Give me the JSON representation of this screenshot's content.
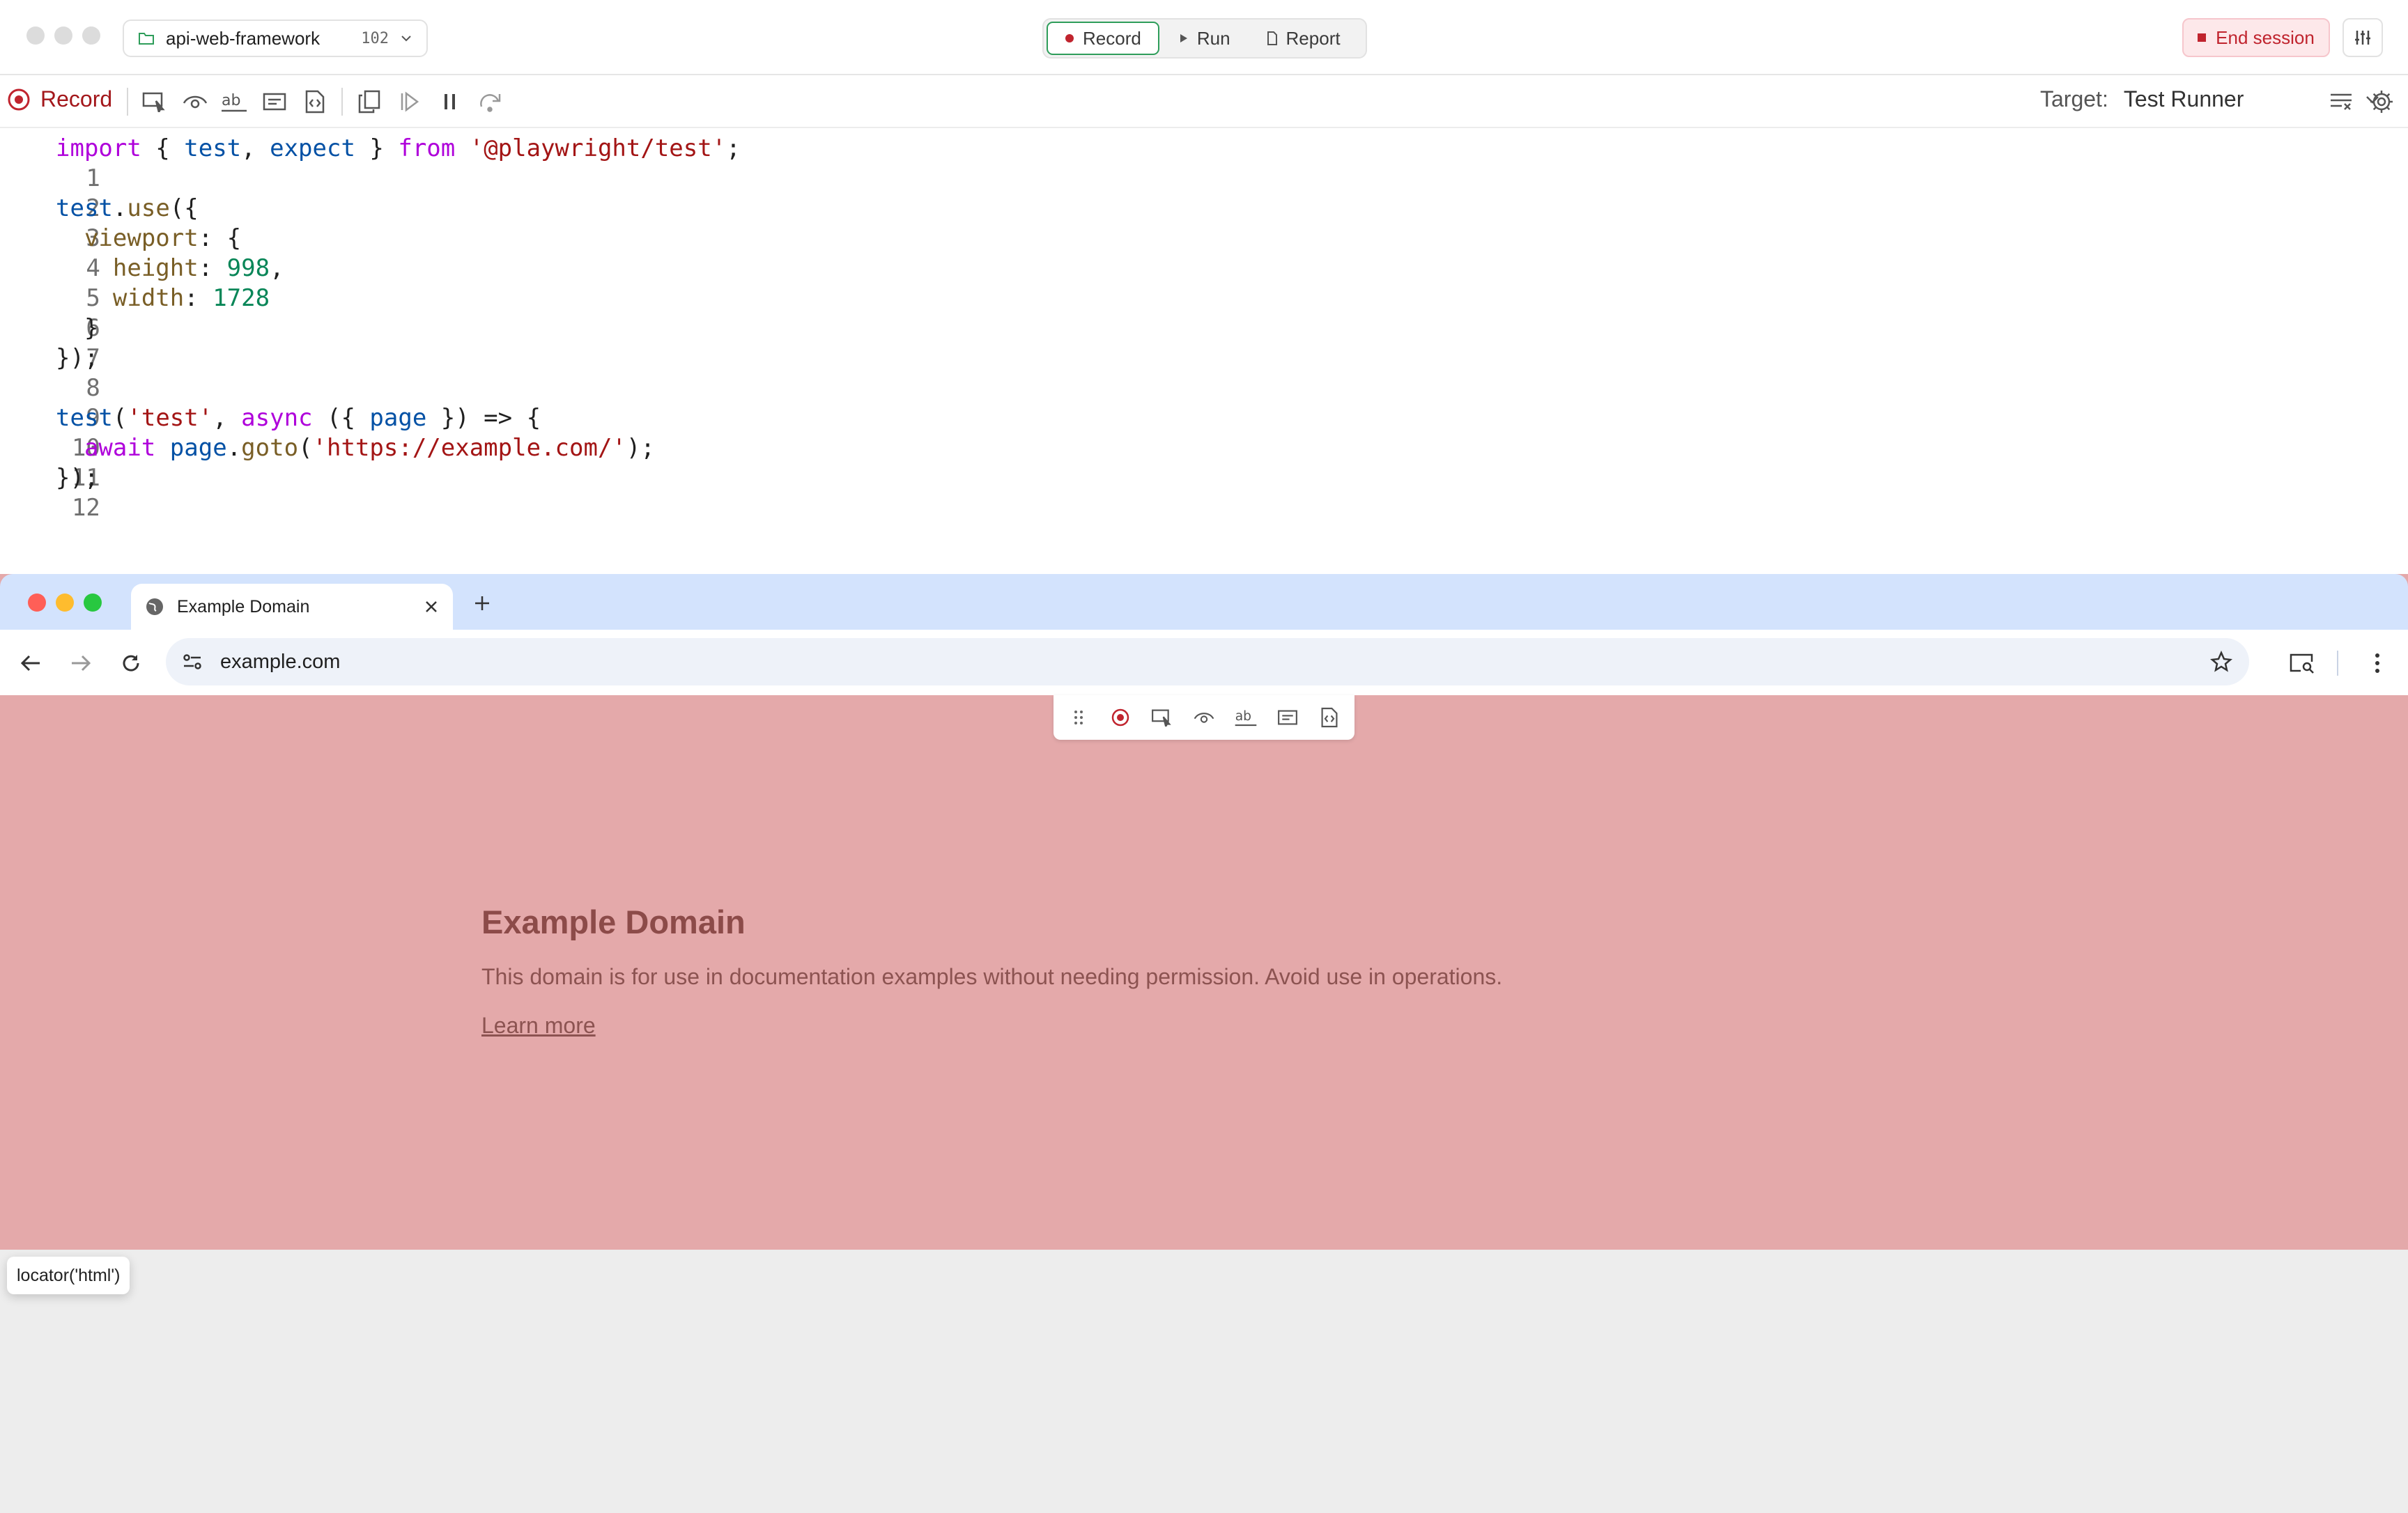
{
  "app": {
    "project_name": "api-web-framework",
    "project_count": "102",
    "modes": [
      {
        "label": "Record",
        "active": true
      },
      {
        "label": "Run",
        "active": false
      },
      {
        "label": "Report",
        "active": false
      }
    ],
    "end_session_label": "End session",
    "accent_color": "#2e9d5a",
    "danger_color": "#c0242e"
  },
  "toolbar": {
    "record_label": "Record",
    "target_label": "Target:",
    "target_value": "Test Runner",
    "icons": [
      "pick-locator-icon",
      "assert-visibility-icon",
      "assert-text-icon",
      "assert-value-icon",
      "assert-snapshot-icon",
      "copy-icon",
      "resume-icon",
      "pause-icon",
      "step-over-icon",
      "clear-icon",
      "settings-icon"
    ]
  },
  "editor": {
    "lines": [
      {
        "n": "1"
      },
      {
        "n": "2"
      },
      {
        "n": "3"
      },
      {
        "n": "4"
      },
      {
        "n": "5"
      },
      {
        "n": "6"
      },
      {
        "n": "7"
      },
      {
        "n": "8"
      },
      {
        "n": "9"
      },
      {
        "n": "10"
      },
      {
        "n": "11"
      },
      {
        "n": "12"
      }
    ],
    "tokens": {
      "l1": [
        "import",
        " { ",
        "test",
        ", ",
        "expect",
        " } ",
        "from",
        " ",
        "'@playwright/test'",
        ";"
      ],
      "l3": [
        "test",
        ".",
        "use",
        "({"
      ],
      "l4": [
        "  ",
        "viewport",
        ": {"
      ],
      "l5": [
        "    ",
        "height",
        ": ",
        "998",
        ","
      ],
      "l6": [
        "    ",
        "width",
        ": ",
        "1728"
      ],
      "l7": [
        "  }"
      ],
      "l8": [
        "});"
      ],
      "l10": [
        "test",
        "(",
        "'test'",
        ", ",
        "async",
        " ({ ",
        "page",
        " }) => {"
      ],
      "l11": [
        "  ",
        "await",
        " ",
        "page",
        ".",
        "goto",
        "(",
        "'https://example.com/'",
        ");"
      ],
      "l12": [
        "});"
      ]
    }
  },
  "browser": {
    "tab_title": "Example Domain",
    "url": "example.com",
    "page": {
      "heading": "Example Domain",
      "body": "This domain is for use in documentation examples without needing permission. Avoid use in operations.",
      "link": "Learn more",
      "highlight_color": "#e4a9aa"
    }
  },
  "tooltip": {
    "text": "locator('html')"
  }
}
